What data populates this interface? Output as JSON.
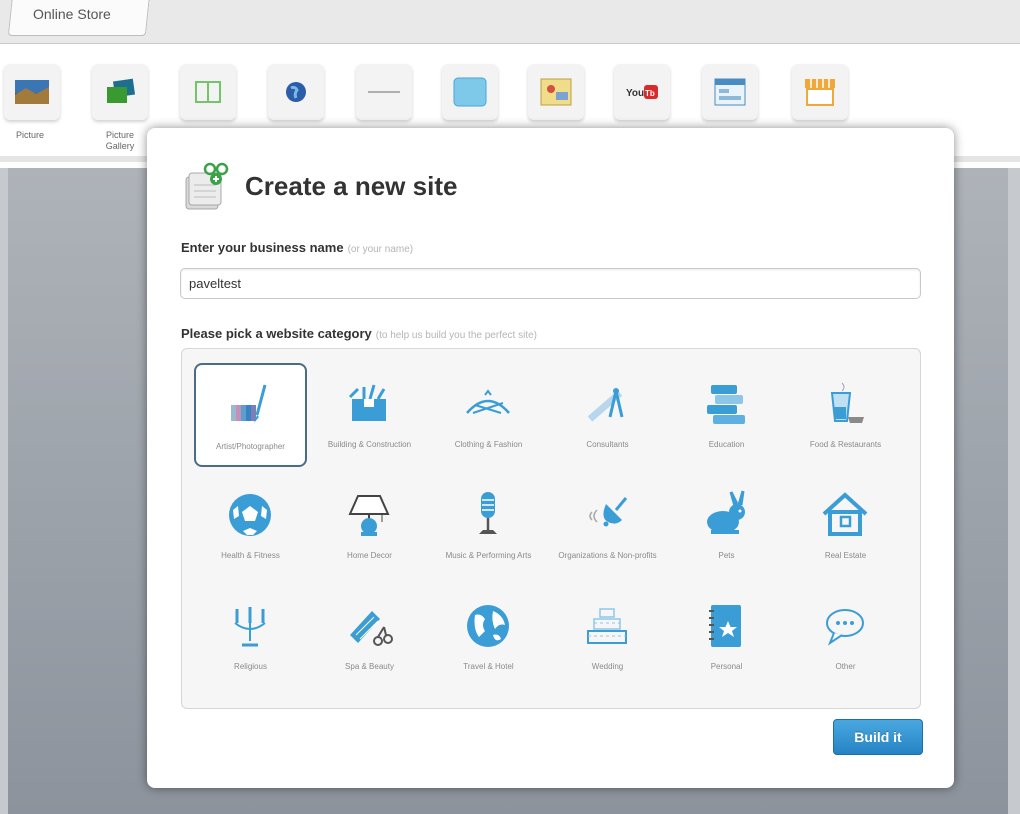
{
  "editor": {
    "tab_label": "Online Store",
    "tools": [
      {
        "label": "Picture",
        "icon": "picture-icon"
      },
      {
        "label": "Picture Gallery",
        "icon": "gallery-icon"
      },
      {
        "label": "",
        "icon": "columns-icon"
      },
      {
        "label": "",
        "icon": "globe-icon"
      },
      {
        "label": "",
        "icon": "divider-icon"
      },
      {
        "label": "",
        "icon": "box-icon"
      },
      {
        "label": "",
        "icon": "map-icon"
      },
      {
        "label": "",
        "icon": "youtube-icon"
      },
      {
        "label": "",
        "icon": "form-icon"
      },
      {
        "label": "",
        "icon": "store-icon"
      }
    ]
  },
  "modal": {
    "title": "Create a new site",
    "business_label": "Enter your business name",
    "business_hint": "(or your name)",
    "business_value": "paveltest",
    "category_label": "Please pick a website category",
    "category_hint": "(to help us build you the perfect site)",
    "build_button": "Build it",
    "accent_color": "#3b9dd6",
    "selected_category": "Artist/Photographer",
    "categories": [
      {
        "label": "Artist/Photographer",
        "icon": "palette-icon"
      },
      {
        "label": "Building & Construction",
        "icon": "toolbox-icon"
      },
      {
        "label": "Clothing & Fashion",
        "icon": "fashion-icon"
      },
      {
        "label": "Consultants",
        "icon": "compass-icon"
      },
      {
        "label": "Education",
        "icon": "books-icon"
      },
      {
        "label": "Food & Restaurants",
        "icon": "food-icon"
      },
      {
        "label": "Health & Fitness",
        "icon": "soccer-ball-icon"
      },
      {
        "label": "Home Decor",
        "icon": "lamp-icon"
      },
      {
        "label": "Music & Performing Arts",
        "icon": "microphone-icon"
      },
      {
        "label": "Organizations & Non-profits",
        "icon": "bell-icon"
      },
      {
        "label": "Pets",
        "icon": "rabbit-icon"
      },
      {
        "label": "Real Estate",
        "icon": "house-icon"
      },
      {
        "label": "Religious",
        "icon": "candelabra-icon"
      },
      {
        "label": "Spa & Beauty",
        "icon": "comb-scissors-icon"
      },
      {
        "label": "Travel & Hotel",
        "icon": "globe-icon"
      },
      {
        "label": "Wedding",
        "icon": "wedding-cake-icon"
      },
      {
        "label": "Personal",
        "icon": "notebook-icon"
      },
      {
        "label": "Other",
        "icon": "speech-bubble-icon"
      }
    ]
  }
}
